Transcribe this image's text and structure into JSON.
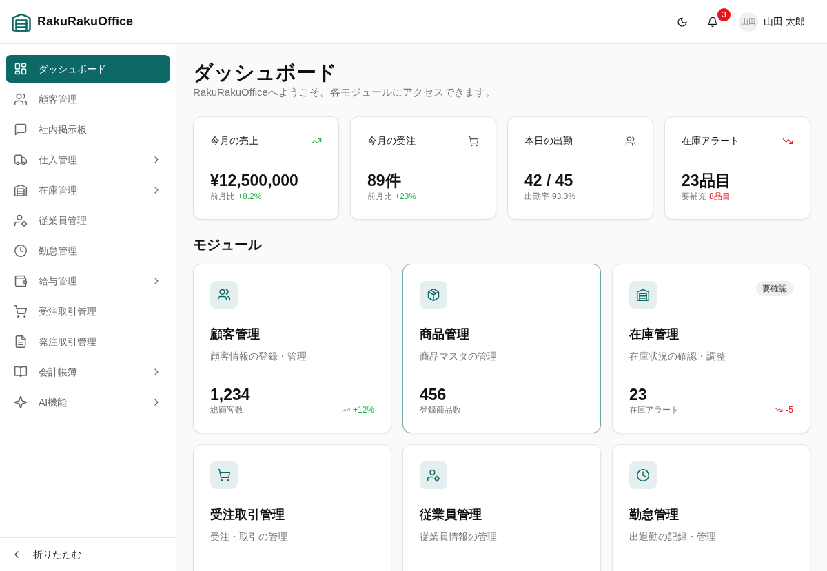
{
  "brand": {
    "name": "RakuRakuOffice"
  },
  "sidebar": {
    "items": [
      {
        "label": "ダッシュボード",
        "selected": true,
        "expandable": false
      },
      {
        "label": "顧客管理",
        "selected": false,
        "expandable": false
      },
      {
        "label": "社内掲示板",
        "selected": false,
        "expandable": false
      },
      {
        "label": "仕入管理",
        "selected": false,
        "expandable": true
      },
      {
        "label": "在庫管理",
        "selected": false,
        "expandable": true
      },
      {
        "label": "従業員管理",
        "selected": false,
        "expandable": false
      },
      {
        "label": "勤怠管理",
        "selected": false,
        "expandable": false
      },
      {
        "label": "給与管理",
        "selected": false,
        "expandable": true
      },
      {
        "label": "受注取引管理",
        "selected": false,
        "expandable": false
      },
      {
        "label": "発注取引管理",
        "selected": false,
        "expandable": false
      },
      {
        "label": "会計帳簿",
        "selected": false,
        "expandable": true
      },
      {
        "label": "AI機能",
        "selected": false,
        "expandable": true
      }
    ],
    "collapse_label": "折りたたむ"
  },
  "header": {
    "notification_count": "3",
    "avatar_text": "山田",
    "user_name": "山田 太郎"
  },
  "page": {
    "title": "ダッシュボード",
    "subtitle": "RakuRakuOfficeへようこそ。各モジュールにアクセスできます。"
  },
  "stats": [
    {
      "title": "今月の売上",
      "value": "¥12,500,000",
      "note_label": "前月比",
      "note_value": "+8.2%",
      "color": "#22b04b"
    },
    {
      "title": "今月の受注",
      "value": "89件",
      "note_label": "前月比",
      "note_value": "+23%",
      "color": "#22b04b"
    },
    {
      "title": "本日の出勤",
      "value": "42 / 45",
      "note_label": "出勤率",
      "note_value": "93.3%",
      "color": "#777777"
    },
    {
      "title": "在庫アラート",
      "value": "23品目",
      "note_label": "要補充",
      "note_value": "8品目",
      "color": "#e7141b"
    }
  ],
  "modules_heading": "モジュール",
  "modules": [
    {
      "title": "顧客管理",
      "description": "顧客情報の登録・管理",
      "count": "1,234",
      "count_label": "総顧客数",
      "trend": "+12%",
      "color": "#22b04b",
      "highlighted": false
    },
    {
      "title": "商品管理",
      "description": "商品マスタの管理",
      "count": "456",
      "count_label": "登録商品数",
      "highlighted": true
    },
    {
      "title": "在庫管理",
      "description": "在庫状況の確認・調整",
      "count": "23",
      "count_label": "在庫アラート",
      "trend": "-5",
      "color": "#e7141b",
      "badge": "要確認",
      "highlighted": false
    },
    {
      "title": "受注取引管理",
      "description": "受注・取引の管理",
      "highlighted": false
    },
    {
      "title": "従業員管理",
      "description": "従業員情報の管理",
      "highlighted": false
    },
    {
      "title": "勤怠管理",
      "description": "出退勤の記録・管理",
      "highlighted": false
    }
  ]
}
